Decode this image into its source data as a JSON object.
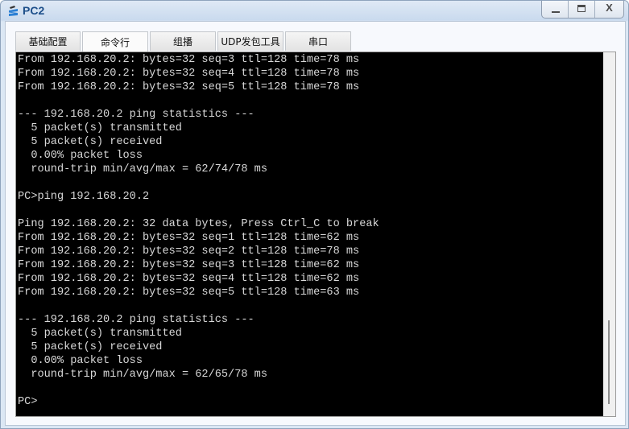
{
  "window": {
    "title": "PC2",
    "icon": "ensp-pc-icon",
    "controls": {
      "minimize_icon": "minimize-icon",
      "maximize_icon": "maximize-icon",
      "close_label": "X"
    }
  },
  "tabs": [
    {
      "label": "基础配置",
      "active": false
    },
    {
      "label": "命令行",
      "active": true
    },
    {
      "label": "组播",
      "active": false
    },
    {
      "label": "UDP发包工具",
      "active": false
    },
    {
      "label": "串口",
      "active": false
    }
  ],
  "terminal": {
    "lines": [
      "From 192.168.20.2: bytes=32 seq=3 ttl=128 time=78 ms",
      "From 192.168.20.2: bytes=32 seq=4 ttl=128 time=78 ms",
      "From 192.168.20.2: bytes=32 seq=5 ttl=128 time=78 ms",
      "",
      "--- 192.168.20.2 ping statistics ---",
      "  5 packet(s) transmitted",
      "  5 packet(s) received",
      "  0.00% packet loss",
      "  round-trip min/avg/max = 62/74/78 ms",
      "",
      "PC>ping 192.168.20.2",
      "",
      "Ping 192.168.20.2: 32 data bytes, Press Ctrl_C to break",
      "From 192.168.20.2: bytes=32 seq=1 ttl=128 time=62 ms",
      "From 192.168.20.2: bytes=32 seq=2 ttl=128 time=78 ms",
      "From 192.168.20.2: bytes=32 seq=3 ttl=128 time=62 ms",
      "From 192.168.20.2: bytes=32 seq=4 ttl=128 time=62 ms",
      "From 192.168.20.2: bytes=32 seq=5 ttl=128 time=63 ms",
      "",
      "--- 192.168.20.2 ping statistics ---",
      "  5 packet(s) transmitted",
      "  5 packet(s) received",
      "  0.00% packet loss",
      "  round-trip min/avg/max = 62/65/78 ms",
      "",
      "PC>"
    ],
    "scroll": {
      "position_fraction": 1.0,
      "visible_fraction": 0.25
    }
  },
  "colors": {
    "terminal_bg": "#000000",
    "terminal_fg": "#d8d8d8",
    "title_text": "#1d4f8a"
  }
}
